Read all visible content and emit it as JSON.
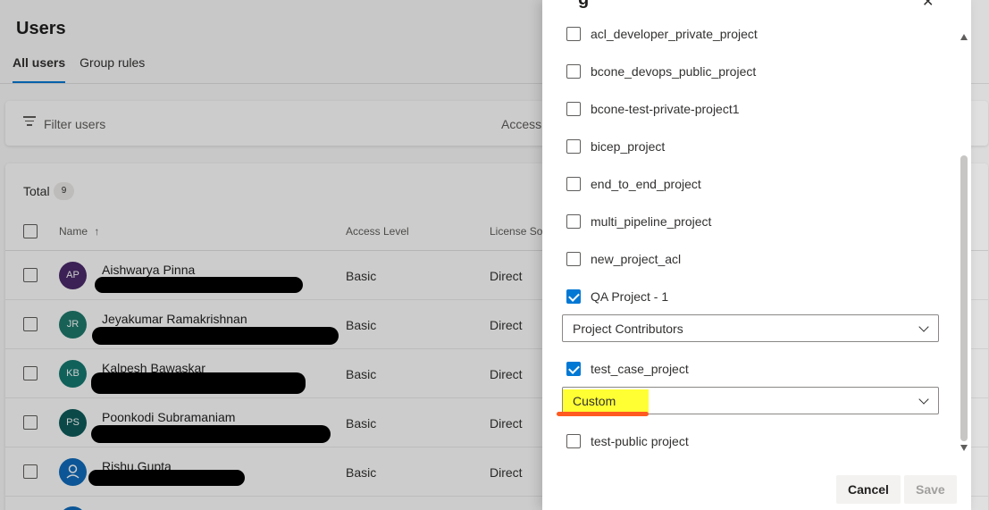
{
  "page": {
    "title": "Users",
    "tabs": [
      {
        "label": "All users",
        "active": true
      },
      {
        "label": "Group rules",
        "active": false
      }
    ],
    "filter_placeholder": "Filter users",
    "access_filter_label": "Access",
    "total_label": "Total",
    "total_count": "9",
    "columns": {
      "name": "Name",
      "sort_indicator": "↑",
      "access_level": "Access Level",
      "license_source": "License Sou"
    },
    "users": [
      {
        "initials": "AP",
        "name": "Aishwarya Pinna",
        "access": "Basic",
        "license": "Direct",
        "avatar_color": "#4a2a6b"
      },
      {
        "initials": "JR",
        "name": "Jeyakumar Ramakrishnan",
        "access": "Basic",
        "license": "Direct",
        "avatar_color": "#1f7a6d"
      },
      {
        "initials": "KB",
        "name": "Kalpesh Bawaskar",
        "access": "Basic",
        "license": "Direct",
        "avatar_color": "#167a72"
      },
      {
        "initials": "PS",
        "name": "Poonkodi Subramaniam",
        "access": "Basic",
        "license": "Direct",
        "avatar_color": "#0e5c5c"
      },
      {
        "initials": "",
        "name": "Rishu.Gupta",
        "access": "Basic",
        "license": "Direct",
        "avatar_color": "#0f6cbd"
      }
    ]
  },
  "panel": {
    "title_fragment": "g",
    "projects": [
      {
        "label": "acl_developer_private_project",
        "checked": false
      },
      {
        "label": "bcone_devops_public_project",
        "checked": false
      },
      {
        "label": "bcone-test-private-project1",
        "checked": false
      },
      {
        "label": "bicep_project",
        "checked": false
      },
      {
        "label": "end_to_end_project",
        "checked": false
      },
      {
        "label": "multi_pipeline_project",
        "checked": false
      },
      {
        "label": "new_project_acl",
        "checked": false
      },
      {
        "label": "QA Project - 1",
        "checked": true
      },
      {
        "label": "test_case_project",
        "checked": true
      },
      {
        "label": "test-public project",
        "checked": false
      }
    ],
    "qa_project_role": "Project Contributors",
    "test_case_project_role": "Custom",
    "cancel_label": "Cancel",
    "save_label": "Save"
  },
  "colors": {
    "accent": "#0078d4",
    "highlight": "#ffff33",
    "underline_mark": "#ff5a1f"
  }
}
